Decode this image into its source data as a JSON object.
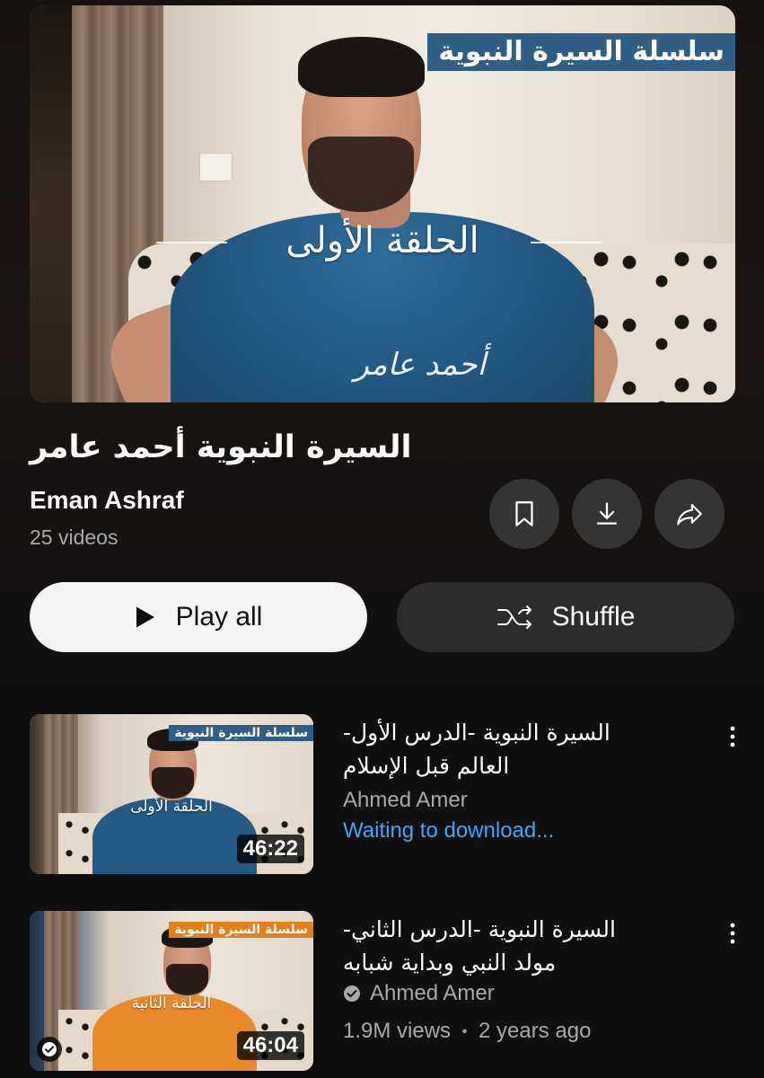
{
  "colors": {
    "accent_link": "#3ea6ff",
    "secondary_text": "#a9a9a9",
    "button_dark": "#2c2c2c",
    "button_light": "#f4f4f4",
    "banner_blue": "#2f5f86",
    "banner_orange": "#e0801f"
  },
  "hero": {
    "series_banner": "سلسلة السيرة النبوية",
    "episode_label": "الحلقة الأولى"
  },
  "playlist": {
    "title": "السيرة النبوية أحمد عامر",
    "owner": "Eman Ashraf",
    "video_count": "25 videos",
    "actions": {
      "save_icon": "bookmark-icon",
      "download_icon": "download-icon",
      "share_icon": "share-icon"
    },
    "play_all_label": "Play all",
    "shuffle_label": "Shuffle"
  },
  "videos": [
    {
      "title_line1": "السيرة النبوية -الدرس الأول-",
      "title_line2": "العالم قبل الإسلام",
      "channel": "Ahmed Amer",
      "status": "Waiting to download...",
      "duration": "46:22",
      "thumb_banner": "سلسلة السيرة النبوية",
      "thumb_episode": "الحلقة الأولى",
      "shirt_color": "#245a83"
    },
    {
      "title_line1": "السيرة النبوية -الدرس الثاني-",
      "title_line2": "مولد النبي وبداية شبابه",
      "channel": "Ahmed Amer",
      "views": "1.9M views",
      "separator": "•",
      "age": "2 years ago",
      "duration": "46:04",
      "thumb_banner": "سلسلة السيرة النبوية",
      "thumb_episode": "الحلقة الثانية",
      "shirt_color": "#e88a2a",
      "downloaded": true
    }
  ]
}
